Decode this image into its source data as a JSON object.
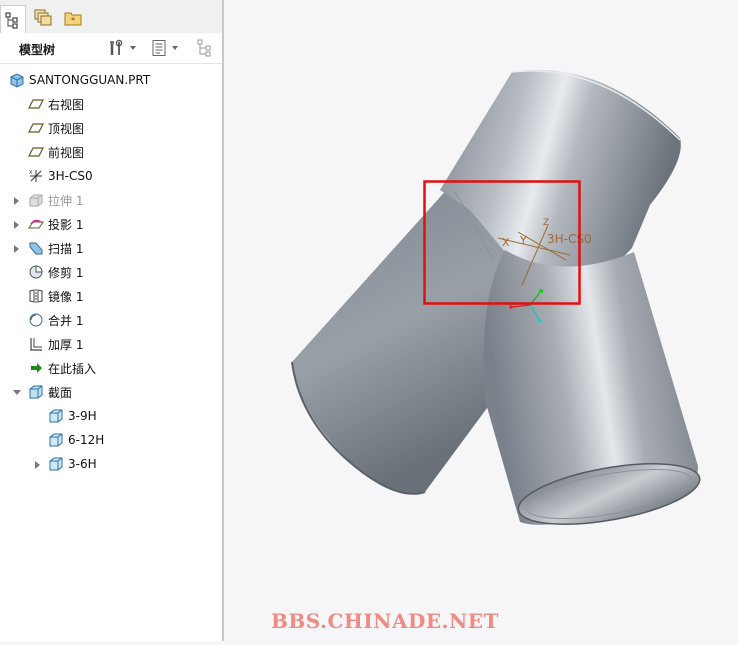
{
  "tabs": [
    {
      "icon": "model-tree-icon",
      "active": true
    },
    {
      "icon": "layers-icon",
      "active": false
    },
    {
      "icon": "favorites-folder-icon",
      "active": false
    }
  ],
  "toolbar": {
    "title": "模型树",
    "settings_icon": "tools-icon",
    "show_icon": "list-icon",
    "filter_icon": "tree-filter-icon"
  },
  "tree": {
    "root": "SANTONGGUAN.PRT",
    "items": [
      {
        "label": "右视图",
        "icon": "datum-plane-icon"
      },
      {
        "label": "顶视图",
        "icon": "datum-plane-icon"
      },
      {
        "label": "前视图",
        "icon": "datum-plane-icon"
      },
      {
        "label": "3H-CS0",
        "icon": "coordinate-system-icon"
      },
      {
        "label": "拉伸 1",
        "icon": "extrude-icon",
        "expandable": true,
        "suppressed": true
      },
      {
        "label": "投影 1",
        "icon": "projection-icon",
        "expandable": true
      },
      {
        "label": "扫描 1",
        "icon": "sweep-icon",
        "expandable": true
      },
      {
        "label": "修剪 1",
        "icon": "trim-icon"
      },
      {
        "label": "镜像 1",
        "icon": "mirror-icon"
      },
      {
        "label": "合并 1",
        "icon": "merge-icon"
      },
      {
        "label": "加厚 1",
        "icon": "thicken-icon"
      },
      {
        "label": "在此插入",
        "icon": "insert-here-arrow-icon"
      },
      {
        "label": "截面",
        "icon": "section-folder-icon",
        "expandable": true,
        "expanded": true
      },
      {
        "label": "3-9H",
        "icon": "section-icon"
      },
      {
        "label": "6-12H",
        "icon": "section-icon"
      },
      {
        "label": "3-6H",
        "icon": "section-icon",
        "expandable": true
      }
    ]
  },
  "viewport": {
    "csys_label": "3H-CS0",
    "axis_x": "X",
    "axis_y": "Y",
    "axis_z": "Z",
    "highlight_color": "#e01010",
    "csys_color": "#9a6a3a"
  },
  "watermark": "BBS.CHINADE.NET"
}
